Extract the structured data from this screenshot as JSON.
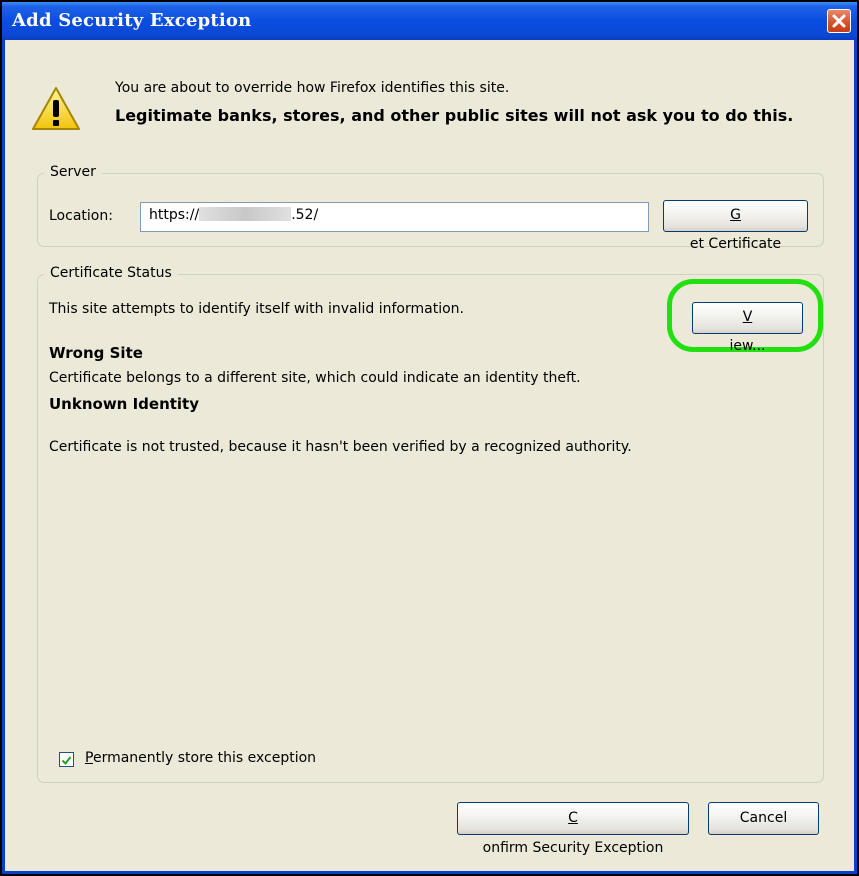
{
  "window": {
    "title": "Add Security Exception"
  },
  "warning": {
    "icon": "warning-icon",
    "line1": "You are about to override how Firefox identifies this site.",
    "line2": "Legitimate banks, stores, and other public sites will not ask you to do this."
  },
  "server": {
    "legend": "Server",
    "location_label": "Location:",
    "location_prefix": "https://",
    "location_suffix": ".52/",
    "get_certificate_button": {
      "mnemonic": "G",
      "rest": "et Certificate"
    }
  },
  "certificate_status": {
    "legend": "Certificate Status",
    "summary": "This site attempts to identify itself with invalid information.",
    "view_button": {
      "mnemonic": "V",
      "rest": "iew..."
    },
    "wrong_site_heading": "Wrong Site",
    "wrong_site_text": "Certificate belongs to a different site, which could indicate an identity theft.",
    "unknown_identity_heading": "Unknown Identity",
    "unknown_identity_text": "Certificate is not trusted, because it hasn't been verified by a recognized authority.",
    "permanent_checkbox": {
      "checked": true,
      "mnemonic": "P",
      "rest": "ermanently store this exception"
    }
  },
  "footer": {
    "confirm_button": {
      "mnemonic": "C",
      "rest": "onfirm Security Exception"
    },
    "cancel_button": "Cancel"
  },
  "colors": {
    "title_bar": "#0a4ee0",
    "dialog_bg": "#ece9d8",
    "highlight": "#22e00f",
    "close_red": "#d6502a"
  }
}
